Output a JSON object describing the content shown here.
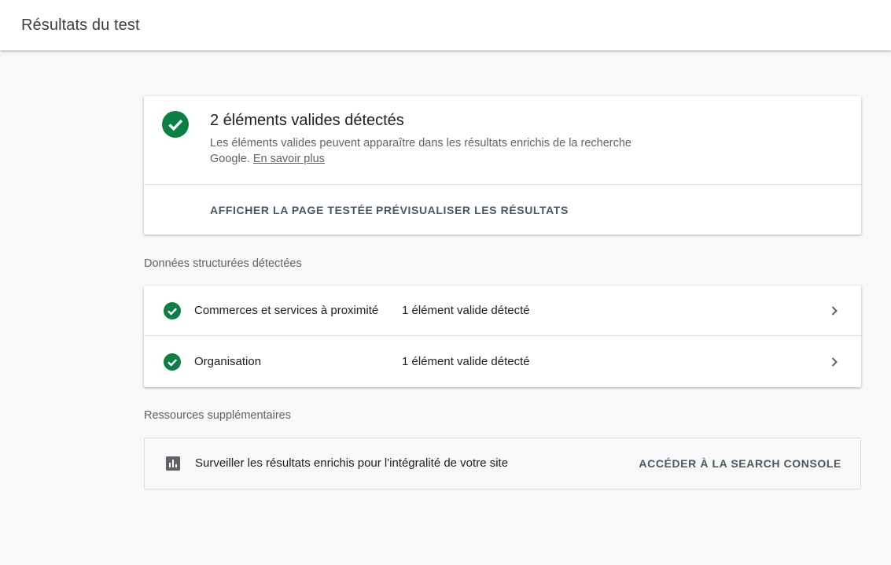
{
  "header": {
    "title": "Résultats du test"
  },
  "summary": {
    "title": "2 éléments valides détectés",
    "description": "Les éléments valides peuvent apparaître dans les résultats enrichis de la recherche Google.",
    "learn_more": "En savoir plus",
    "status_icon": "check-circle-icon",
    "status_color": "#0b8043",
    "actions": {
      "view_page": "AFFICHER LA PAGE TESTÉE",
      "preview_results": "PRÉVISUALISER LES RÉSULTATS"
    }
  },
  "structured_data": {
    "label": "Données structurées détectées",
    "items": [
      {
        "name": "Commerces et services à proximité",
        "status": "1 élément valide détecté",
        "icon": "check-circle-icon"
      },
      {
        "name": "Organisation",
        "status": "1 élément valide détecté",
        "icon": "check-circle-icon"
      }
    ]
  },
  "resources": {
    "label": "Ressources supplémentaires",
    "item": {
      "icon": "bar-chart-icon",
      "text": "Surveiller les résultats enrichis pour l'intégralité de votre site",
      "action": "ACCÉDER À LA SEARCH CONSOLE"
    }
  }
}
